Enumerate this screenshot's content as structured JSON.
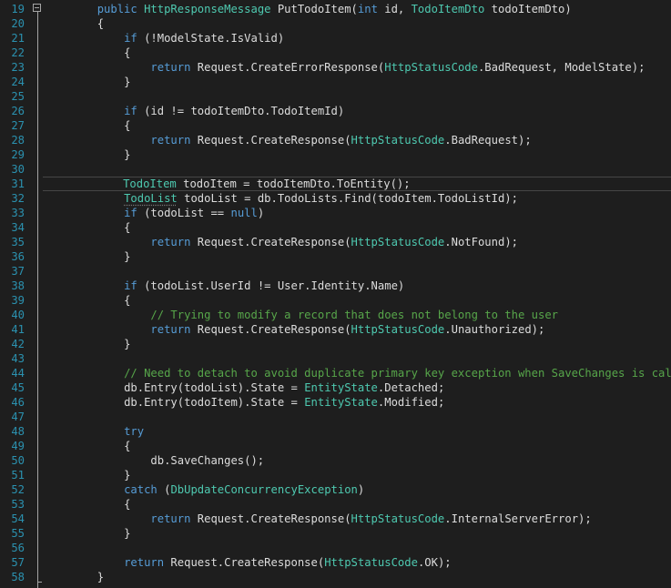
{
  "colors": {
    "background": "#1e1e1e",
    "plain_text": "#dcdcdc",
    "keyword": "#569cd6",
    "type": "#4ec9b0",
    "comment": "#57a64a",
    "line_number": "#2b91af",
    "indent_guide": "#3f3f3f"
  },
  "icons": {
    "fold": "collapse-minus-icon"
  },
  "current_line_number": "31",
  "lines": [
    {
      "num": "19",
      "indent": 2,
      "tokens": [
        [
          "kw",
          "public"
        ],
        [
          "plain",
          " "
        ],
        [
          "type",
          "HttpResponseMessage"
        ],
        [
          "plain",
          " PutTodoItem("
        ],
        [
          "kw",
          "int"
        ],
        [
          "plain",
          " id, "
        ],
        [
          "type",
          "TodoItemDto"
        ],
        [
          "plain",
          " todoItemDto)"
        ]
      ]
    },
    {
      "num": "20",
      "indent": 2,
      "tokens": [
        [
          "plain",
          "{"
        ]
      ]
    },
    {
      "num": "21",
      "indent": 3,
      "tokens": [
        [
          "kw",
          "if"
        ],
        [
          "plain",
          " (!ModelState.IsValid)"
        ]
      ]
    },
    {
      "num": "22",
      "indent": 3,
      "tokens": [
        [
          "plain",
          "{"
        ]
      ]
    },
    {
      "num": "23",
      "indent": 4,
      "tokens": [
        [
          "kw",
          "return"
        ],
        [
          "plain",
          " Request.CreateErrorResponse("
        ],
        [
          "type",
          "HttpStatusCode"
        ],
        [
          "plain",
          ".BadRequest, ModelState);"
        ]
      ]
    },
    {
      "num": "24",
      "indent": 3,
      "tokens": [
        [
          "plain",
          "}"
        ]
      ]
    },
    {
      "num": "25",
      "indent": 0,
      "tokens": []
    },
    {
      "num": "26",
      "indent": 3,
      "tokens": [
        [
          "kw",
          "if"
        ],
        [
          "plain",
          " (id != todoItemDto.TodoItemId)"
        ]
      ]
    },
    {
      "num": "27",
      "indent": 3,
      "tokens": [
        [
          "plain",
          "{"
        ]
      ]
    },
    {
      "num": "28",
      "indent": 4,
      "tokens": [
        [
          "kw",
          "return"
        ],
        [
          "plain",
          " Request.CreateResponse("
        ],
        [
          "type",
          "HttpStatusCode"
        ],
        [
          "plain",
          ".BadRequest);"
        ]
      ]
    },
    {
      "num": "29",
      "indent": 3,
      "tokens": [
        [
          "plain",
          "}"
        ]
      ]
    },
    {
      "num": "30",
      "indent": 0,
      "tokens": []
    },
    {
      "num": "31",
      "indent": 3,
      "tokens": [
        [
          "type",
          "TodoItem"
        ],
        [
          "plain",
          " todoItem = todoItemDto.ToEntity();"
        ]
      ]
    },
    {
      "num": "32",
      "indent": 3,
      "tokens": [
        [
          "type",
          "TodoList"
        ],
        [
          "plain",
          " todoList = db.TodoLists.Find(todoItem.TodoListId);"
        ]
      ]
    },
    {
      "num": "33",
      "indent": 3,
      "tokens": [
        [
          "kw",
          "if"
        ],
        [
          "plain",
          " (todoList == "
        ],
        [
          "kw",
          "null"
        ],
        [
          "plain",
          ")"
        ]
      ]
    },
    {
      "num": "34",
      "indent": 3,
      "tokens": [
        [
          "plain",
          "{"
        ]
      ]
    },
    {
      "num": "35",
      "indent": 4,
      "tokens": [
        [
          "kw",
          "return"
        ],
        [
          "plain",
          " Request.CreateResponse("
        ],
        [
          "type",
          "HttpStatusCode"
        ],
        [
          "plain",
          ".NotFound);"
        ]
      ]
    },
    {
      "num": "36",
      "indent": 3,
      "tokens": [
        [
          "plain",
          "}"
        ]
      ]
    },
    {
      "num": "37",
      "indent": 0,
      "tokens": []
    },
    {
      "num": "38",
      "indent": 3,
      "tokens": [
        [
          "kw",
          "if"
        ],
        [
          "plain",
          " (todoList.UserId != User.Identity.Name)"
        ]
      ]
    },
    {
      "num": "39",
      "indent": 3,
      "tokens": [
        [
          "plain",
          "{"
        ]
      ]
    },
    {
      "num": "40",
      "indent": 4,
      "tokens": [
        [
          "comment",
          "// Trying to modify a record that does not belong to the user"
        ]
      ]
    },
    {
      "num": "41",
      "indent": 4,
      "tokens": [
        [
          "kw",
          "return"
        ],
        [
          "plain",
          " Request.CreateResponse("
        ],
        [
          "type",
          "HttpStatusCode"
        ],
        [
          "plain",
          ".Unauthorized);"
        ]
      ]
    },
    {
      "num": "42",
      "indent": 3,
      "tokens": [
        [
          "plain",
          "}"
        ]
      ]
    },
    {
      "num": "43",
      "indent": 0,
      "tokens": []
    },
    {
      "num": "44",
      "indent": 3,
      "tokens": [
        [
          "comment",
          "// Need to detach to avoid duplicate primary key exception when SaveChanges is called"
        ]
      ]
    },
    {
      "num": "45",
      "indent": 3,
      "tokens": [
        [
          "plain",
          "db.Entry(todoList).State = "
        ],
        [
          "type",
          "EntityState"
        ],
        [
          "plain",
          ".Detached;"
        ]
      ]
    },
    {
      "num": "46",
      "indent": 3,
      "tokens": [
        [
          "plain",
          "db.Entry(todoItem).State = "
        ],
        [
          "type",
          "EntityState"
        ],
        [
          "plain",
          ".Modified;"
        ]
      ]
    },
    {
      "num": "47",
      "indent": 0,
      "tokens": []
    },
    {
      "num": "48",
      "indent": 3,
      "tokens": [
        [
          "kw",
          "try"
        ]
      ]
    },
    {
      "num": "49",
      "indent": 3,
      "tokens": [
        [
          "plain",
          "{"
        ]
      ]
    },
    {
      "num": "50",
      "indent": 4,
      "tokens": [
        [
          "plain",
          "db.SaveChanges();"
        ]
      ]
    },
    {
      "num": "51",
      "indent": 3,
      "tokens": [
        [
          "plain",
          "}"
        ]
      ]
    },
    {
      "num": "52",
      "indent": 3,
      "tokens": [
        [
          "kw",
          "catch"
        ],
        [
          "plain",
          " ("
        ],
        [
          "type",
          "DbUpdateConcurrencyException"
        ],
        [
          "plain",
          ")"
        ]
      ]
    },
    {
      "num": "53",
      "indent": 3,
      "tokens": [
        [
          "plain",
          "{"
        ]
      ]
    },
    {
      "num": "54",
      "indent": 4,
      "tokens": [
        [
          "kw",
          "return"
        ],
        [
          "plain",
          " Request.CreateResponse("
        ],
        [
          "type",
          "HttpStatusCode"
        ],
        [
          "plain",
          ".InternalServerError);"
        ]
      ]
    },
    {
      "num": "55",
      "indent": 3,
      "tokens": [
        [
          "plain",
          "}"
        ]
      ]
    },
    {
      "num": "56",
      "indent": 0,
      "tokens": []
    },
    {
      "num": "57",
      "indent": 3,
      "tokens": [
        [
          "kw",
          "return"
        ],
        [
          "plain",
          " Request.CreateResponse("
        ],
        [
          "type",
          "HttpStatusCode"
        ],
        [
          "plain",
          ".OK);"
        ]
      ]
    },
    {
      "num": "58",
      "indent": 2,
      "tokens": [
        [
          "plain",
          "}"
        ]
      ]
    }
  ]
}
